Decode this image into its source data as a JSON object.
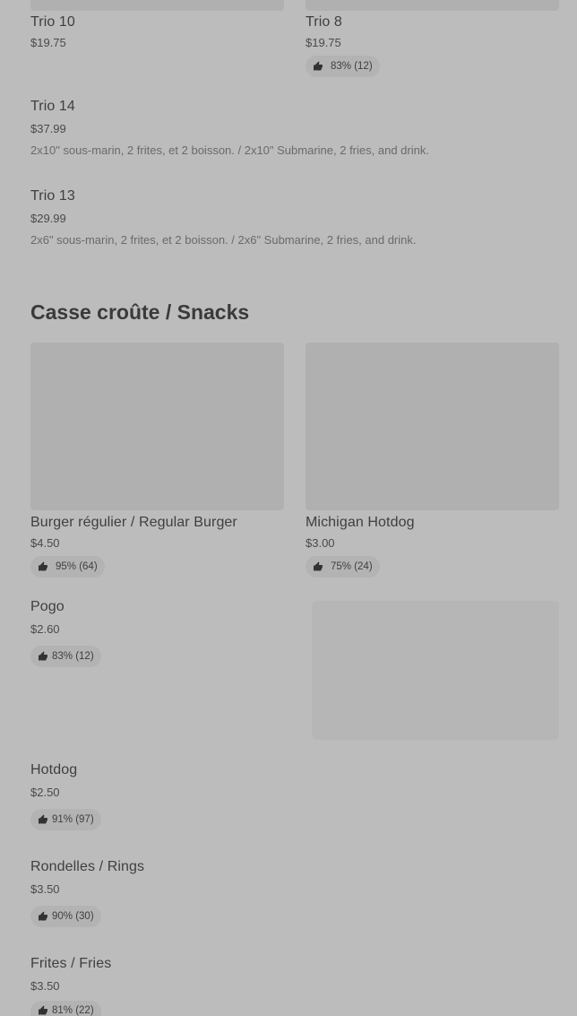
{
  "trio_row_top": {
    "left": {
      "name": "Trio 10",
      "price": "$19.75"
    },
    "right": {
      "name": "Trio 8",
      "price": "$19.75",
      "rating": "83% (12)"
    }
  },
  "list_items": [
    {
      "name": "Trio 14",
      "price": "$37.99",
      "desc": "2x10\" sous-marin, 2 frites, et 2 boisson. / 2x10\" Submarine, 2 fries, and drink."
    },
    {
      "name": "Trio 13",
      "price": "$29.99",
      "desc": "2x6\" sous-marin, 2 frites, et 2 boisson. / 2x6\" Submarine, 2 fries, and drink."
    }
  ],
  "snacks": {
    "title": "Casse croûte / Snacks",
    "cards": [
      {
        "name": "Burger régulier / Regular Burger",
        "price": "$4.50",
        "rating": "95% (64)"
      },
      {
        "name": "Michigan Hotdog",
        "price": "$3.00",
        "rating": "75% (24)"
      }
    ],
    "items": [
      {
        "name": "Pogo",
        "price": "$2.60",
        "rating": "83% (12)"
      },
      {
        "name": "Hotdog",
        "price": "$2.50",
        "rating": "91% (97)"
      },
      {
        "name": "Rondelles / Rings",
        "price": "$3.50",
        "rating": "90% (30)"
      },
      {
        "name": "Frites / Fries",
        "price": "$3.50",
        "rating": "81% (22)"
      }
    ]
  },
  "icons": {
    "rating": "thumbs-up-icon"
  }
}
